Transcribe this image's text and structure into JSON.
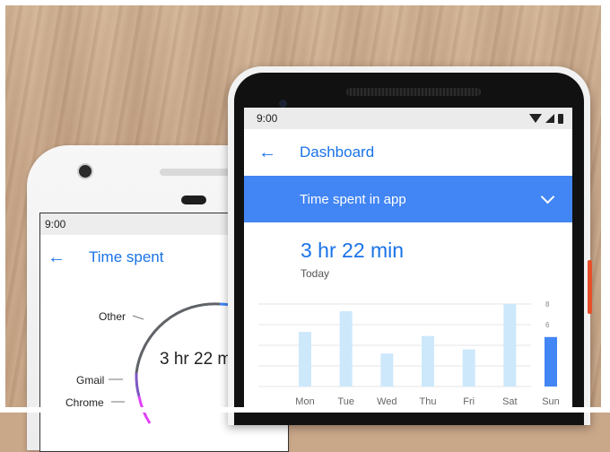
{
  "left_phone": {
    "status_time": "9:00",
    "title": "Time spent",
    "back_icon": "back-arrow-icon",
    "ring": {
      "labels": [
        "Other",
        "Gmail",
        "Chrome"
      ],
      "total": "3 hr 22 m",
      "colors": {
        "other": "#5f6368",
        "gmail": "#7e57c2",
        "chrome": "#e040fb",
        "accent": "#4285f4"
      }
    }
  },
  "right_phone": {
    "status_time": "9:00",
    "status_icons": [
      "wifi-icon",
      "signal-icon",
      "battery-icon"
    ],
    "title": "Dashboard",
    "back_icon": "back-arrow-icon",
    "selector": {
      "label": "Time spent in app",
      "icon": "chevron-down-icon"
    },
    "total_time": "3 hr 22 min",
    "period": "Today",
    "accent_color": "#4285f4"
  },
  "chart_data": {
    "type": "bar",
    "categories": [
      "Mon",
      "Tue",
      "Wed",
      "Thu",
      "Fri",
      "Sat",
      "Sun"
    ],
    "values": [
      5.3,
      7.3,
      3.2,
      4.9,
      3.6,
      8.0,
      4.8
    ],
    "highlighted": "Sun",
    "ylim": [
      0,
      8
    ],
    "yticks": [
      2,
      4,
      6,
      8
    ],
    "grid": true,
    "bar_color": "#cde8fb",
    "highlight_color": "#4285f4"
  }
}
